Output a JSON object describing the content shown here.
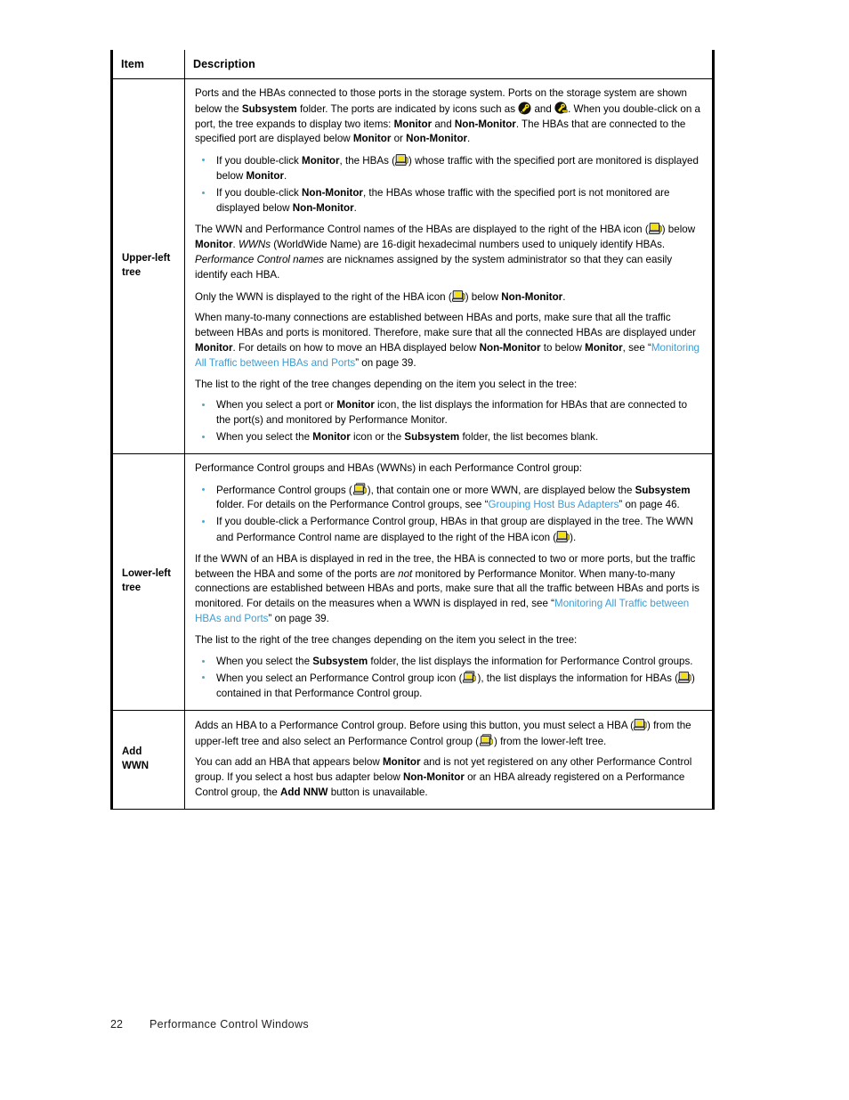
{
  "document": {
    "table": {
      "headers": [
        "Item",
        "Description"
      ],
      "rows": [
        {
          "item": "Upper-left\ntree",
          "item_line1": "Upper-left",
          "item_line2": "tree"
        },
        {
          "item_line1": "Lower-left",
          "item_line2": "tree"
        },
        {
          "item_line1": "Add",
          "item_line2": "WWN"
        }
      ]
    },
    "upper_left_tree": {
      "p1_a": "Ports and the HBAs connected to those ports in the storage system. Ports on the storage system are shown below the ",
      "p1_b": "Subsystem",
      "p1_c": " folder. The ports are indicated by icons such as ",
      "p1_d": " and ",
      "p1_e": ". When you double-click on a port, the tree expands to display two items: ",
      "p1_f": "Monitor",
      "p1_g": " and ",
      "p1_h": "Non-Monitor",
      "p1_i": ". The HBAs that are connected to the specified port are displayed below ",
      "p1_j": "Monitor",
      "p1_k": " or ",
      "p1_l": "Non-Monitor",
      "p1_m": ".",
      "b1_a": "If you double-click ",
      "b1_b": "Monitor",
      "b1_c": ", the HBAs (",
      "b1_d": ") whose traffic with the specified port are monitored is displayed below ",
      "b1_e": "Monitor",
      "b1_f": ".",
      "b2_a": "If you double-click ",
      "b2_b": "Non-Monitor",
      "b2_c": ", the HBAs whose traffic with the specified port is not monitored are displayed below ",
      "b2_d": "Non-Monitor",
      "b2_e": ".",
      "p2_a": "The WWN and Performance Control names of the HBAs are displayed to the right of the HBA icon (",
      "p2_b": ") below ",
      "p2_c": "Monitor",
      "p2_d": ". ",
      "p2_e": "WWNs",
      "p2_f": " (WorldWide Name) are 16-digit hexadecimal numbers used to uniquely identify HBAs. ",
      "p2_g": "Performance Control names",
      "p2_h": " are nicknames assigned by the system administrator so that they can easily identify each HBA.",
      "p3_a": "Only the WWN is displayed to the right of the HBA icon (",
      "p3_b": ") below ",
      "p3_c": "Non-Monitor",
      "p3_d": ".",
      "p4_a": "When many-to-many connections are established between HBAs and ports, make sure that all the traffic between HBAs and ports is monitored. Therefore, make sure that all the connected HBAs are displayed under ",
      "p4_b": "Monitor",
      "p4_c": ". For details on how to move an HBA displayed below ",
      "p4_d": "Non-Monitor",
      "p4_e": " to below ",
      "p4_f": "Monitor",
      "p4_g": ", see “",
      "p4_link": "Monitoring All Traffic between HBAs and Ports",
      "p4_h": "” on page 39.",
      "p5": "The list to the right of the tree changes depending on the item you select in the tree:",
      "b3_a": "When you select a port or ",
      "b3_b": "Monitor",
      "b3_c": " icon, the list displays the information for HBAs that are connected to the port(s) and monitored by Performance Monitor.",
      "b4_a": "When you select the ",
      "b4_b": "Monitor",
      "b4_c": " icon or the ",
      "b4_d": "Subsystem",
      "b4_e": " folder, the list becomes blank."
    },
    "lower_left_tree": {
      "p1": "Performance Control groups and HBAs (WWNs) in each Performance Control group:",
      "b1_a": "Performance Control groups (",
      "b1_b": "), that contain one or more WWN, are displayed below the ",
      "b1_c": "Subsystem",
      "b1_d": " folder. For details on the Performance Control groups, see “",
      "b1_link": "Grouping Host Bus Adapters",
      "b1_e": "” on page 46.",
      "b2_a": "If you double-click a Performance Control group, HBAs in that group are displayed in the tree. The WWN and Performance Control name are displayed to the right of the HBA icon (",
      "b2_b": ").",
      "p2_a": "If the WWN of an HBA is displayed in red in the tree, the HBA is connected to two or more ports, but the traffic between the HBA and some of the ports are ",
      "p2_b": "not",
      "p2_c": " monitored by Performance Monitor. When many-to-many connections are established between HBAs and ports, make sure that all the traffic between HBAs and ports is monitored. For details on the measures when a WWN is displayed in red, see “",
      "p2_link": "Monitoring All Traffic between HBAs and Ports",
      "p2_d": "” on page 39.",
      "p3": "The list to the right of the tree changes depending on the item you select in the tree:",
      "b3_a": "When you select the ",
      "b3_b": "Subsystem",
      "b3_c": " folder, the list displays the information for Performance Control groups.",
      "b4_a": "When you select an Performance Control group icon (",
      "b4_b": "), the list displays the information for HBAs (",
      "b4_c": ") contained in that Performance Control group."
    },
    "add_wwn": {
      "p1_a": "Adds an HBA to a Performance Control group. Before using this button, you must select a HBA (",
      "p1_b": ") from the upper-left tree and also select an Performance Control group (",
      "p1_c": ") from the lower-left tree.",
      "p2_a": "You can add an HBA that appears below ",
      "p2_b": "Monitor",
      "p2_c": " and is not yet registered on any other Performance Control group. If you select a host bus adapter below ",
      "p2_d": "Non-Monitor",
      "p2_e": " or an HBA already registered on a Performance Control group, the ",
      "p2_f": "Add NNW",
      "p2_g": " button is unavailable."
    },
    "footer": {
      "page_number": "22",
      "section_title": "Performance Control Windows"
    },
    "icons": {
      "port_a": "port-icon",
      "port_b": "port-connected-icon",
      "hba": "hba-icon",
      "group": "performance-control-group-icon"
    },
    "colors": {
      "link": "#3b9dd4",
      "bullet": "#4aa8d8",
      "icon_yellow": "#f2e314",
      "icon_dark": "#1a1a1a"
    }
  }
}
